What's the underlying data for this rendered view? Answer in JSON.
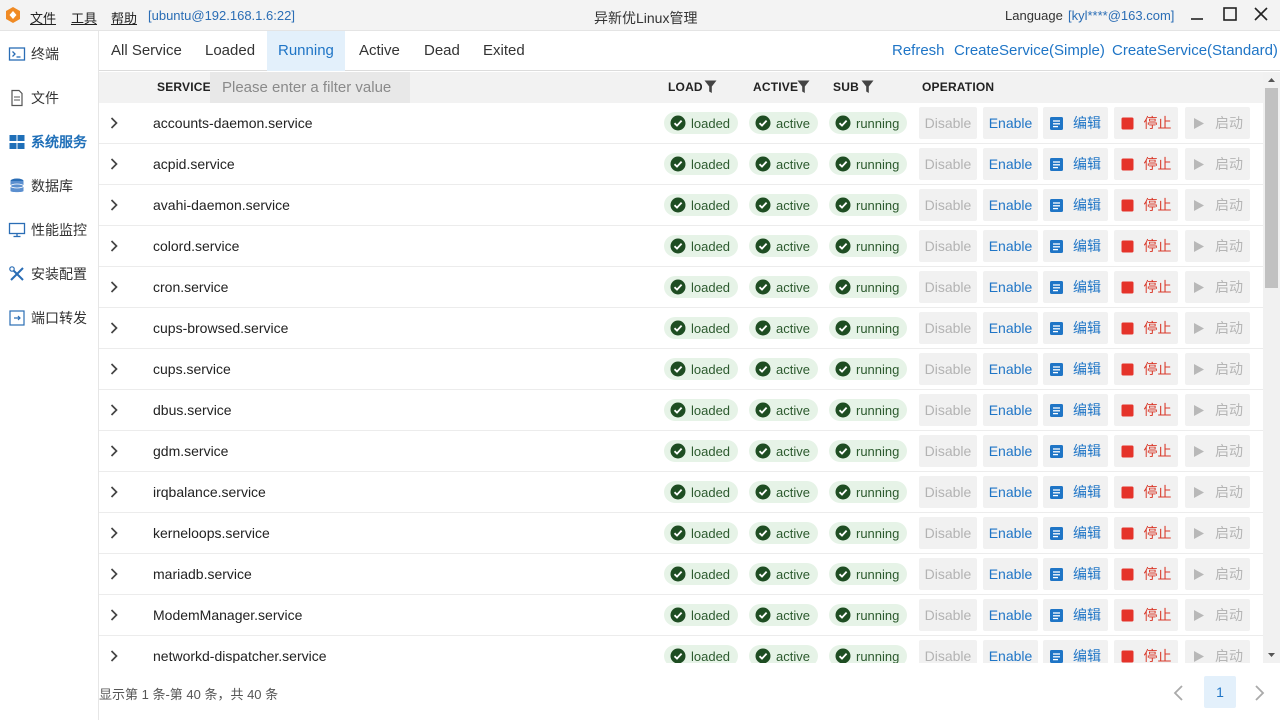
{
  "titlebar": {
    "menu": [
      "文件",
      "工具",
      "帮助"
    ],
    "host": "[ubuntu@192.168.1.6:22]",
    "title": "异新优Linux管理",
    "language_label": "Language",
    "user": "[kyl****@163.com]"
  },
  "sidebar": {
    "items": [
      {
        "label": "终端",
        "icon": "terminal-icon"
      },
      {
        "label": "文件",
        "icon": "file-icon"
      },
      {
        "label": "系统服务",
        "icon": "services-icon"
      },
      {
        "label": "数据库",
        "icon": "database-icon"
      },
      {
        "label": "性能监控",
        "icon": "monitor-icon"
      },
      {
        "label": "安装配置",
        "icon": "tools-icon"
      },
      {
        "label": "端口转发",
        "icon": "port-forward-icon"
      }
    ],
    "active": "系统服务"
  },
  "tabs": [
    "All Service",
    "Loaded",
    "Running",
    "Active",
    "Dead",
    "Exited"
  ],
  "active_tab": "Running",
  "actions": {
    "refresh": "Refresh",
    "create_simple": "CreateService(Simple)",
    "create_standard": "CreateService(Standard)"
  },
  "table": {
    "headers": {
      "service": "SERVICE",
      "load": "LOAD",
      "active": "ACTIVE",
      "sub": "SUB",
      "operation": "OPERATION"
    },
    "filter_placeholder": "Please enter a filter value",
    "buttons": {
      "disable": "Disable",
      "enable": "Enable",
      "edit": "编辑",
      "stop": "停止",
      "start": "启动"
    },
    "rows": [
      {
        "service": "accounts-daemon.service",
        "load": "loaded",
        "active": "active",
        "sub": "running"
      },
      {
        "service": "acpid.service",
        "load": "loaded",
        "active": "active",
        "sub": "running"
      },
      {
        "service": "avahi-daemon.service",
        "load": "loaded",
        "active": "active",
        "sub": "running"
      },
      {
        "service": "colord.service",
        "load": "loaded",
        "active": "active",
        "sub": "running"
      },
      {
        "service": "cron.service",
        "load": "loaded",
        "active": "active",
        "sub": "running"
      },
      {
        "service": "cups-browsed.service",
        "load": "loaded",
        "active": "active",
        "sub": "running"
      },
      {
        "service": "cups.service",
        "load": "loaded",
        "active": "active",
        "sub": "running"
      },
      {
        "service": "dbus.service",
        "load": "loaded",
        "active": "active",
        "sub": "running"
      },
      {
        "service": "gdm.service",
        "load": "loaded",
        "active": "active",
        "sub": "running"
      },
      {
        "service": "irqbalance.service",
        "load": "loaded",
        "active": "active",
        "sub": "running"
      },
      {
        "service": "kerneloops.service",
        "load": "loaded",
        "active": "active",
        "sub": "running"
      },
      {
        "service": "mariadb.service",
        "load": "loaded",
        "active": "active",
        "sub": "running"
      },
      {
        "service": "ModemManager.service",
        "load": "loaded",
        "active": "active",
        "sub": "running"
      },
      {
        "service": "networkd-dispatcher.service",
        "load": "loaded",
        "active": "active",
        "sub": "running"
      }
    ]
  },
  "pagination": {
    "info": "显示第 1 条-第 40 条，共 40 条",
    "current_page": "1"
  },
  "colors": {
    "accent": "#1f75c6",
    "active_tab_bg": "#e3f0fb",
    "badge_bg": "#e6f3e7",
    "stop_red": "#d9392a"
  }
}
